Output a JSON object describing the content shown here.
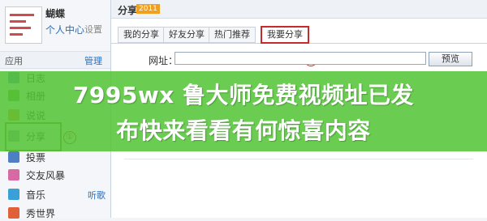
{
  "user": {
    "name": "蝴蝶",
    "center": "个人中心",
    "settings": "设置"
  },
  "apps_section": {
    "title": "应用",
    "manage": "管理"
  },
  "apps": [
    {
      "label": "日志",
      "icon": "log-icon",
      "color": "#5b8fd6"
    },
    {
      "label": "相册",
      "icon": "album-icon",
      "color": "#6fb04a"
    },
    {
      "label": "说说",
      "icon": "talk-icon",
      "color": "#e59a2f"
    },
    {
      "label": "分享",
      "icon": "share-icon",
      "color": "#9aa8b8"
    },
    {
      "label": "投票",
      "icon": "vote-icon",
      "color": "#4d7fc2"
    },
    {
      "label": "交友风暴",
      "icon": "friend-storm-icon",
      "color": "#d86aa3"
    },
    {
      "label": "音乐",
      "icon": "music-icon",
      "color": "#3aa0d8",
      "extra": "听歌"
    },
    {
      "label": "秀世界",
      "icon": "show-world-icon",
      "color": "#e0603a"
    }
  ],
  "main": {
    "title": "分享",
    "badge": "2011",
    "tabs": [
      "我的分享",
      "好友分享",
      "热门推荐",
      "我要分享"
    ],
    "url_label": "网址：",
    "preview_button": "预览",
    "url_value": ""
  },
  "annotations": {
    "share_marker": "①",
    "tab_marker": "②"
  },
  "banner": {
    "line1": "7995wx 鲁大师免费视频址已发",
    "line2": "布快来看看有何惊喜内容"
  },
  "colors": {
    "highlight_red": "#c62a2a",
    "banner_green": "#52c434",
    "link_blue": "#2a6ebb"
  }
}
